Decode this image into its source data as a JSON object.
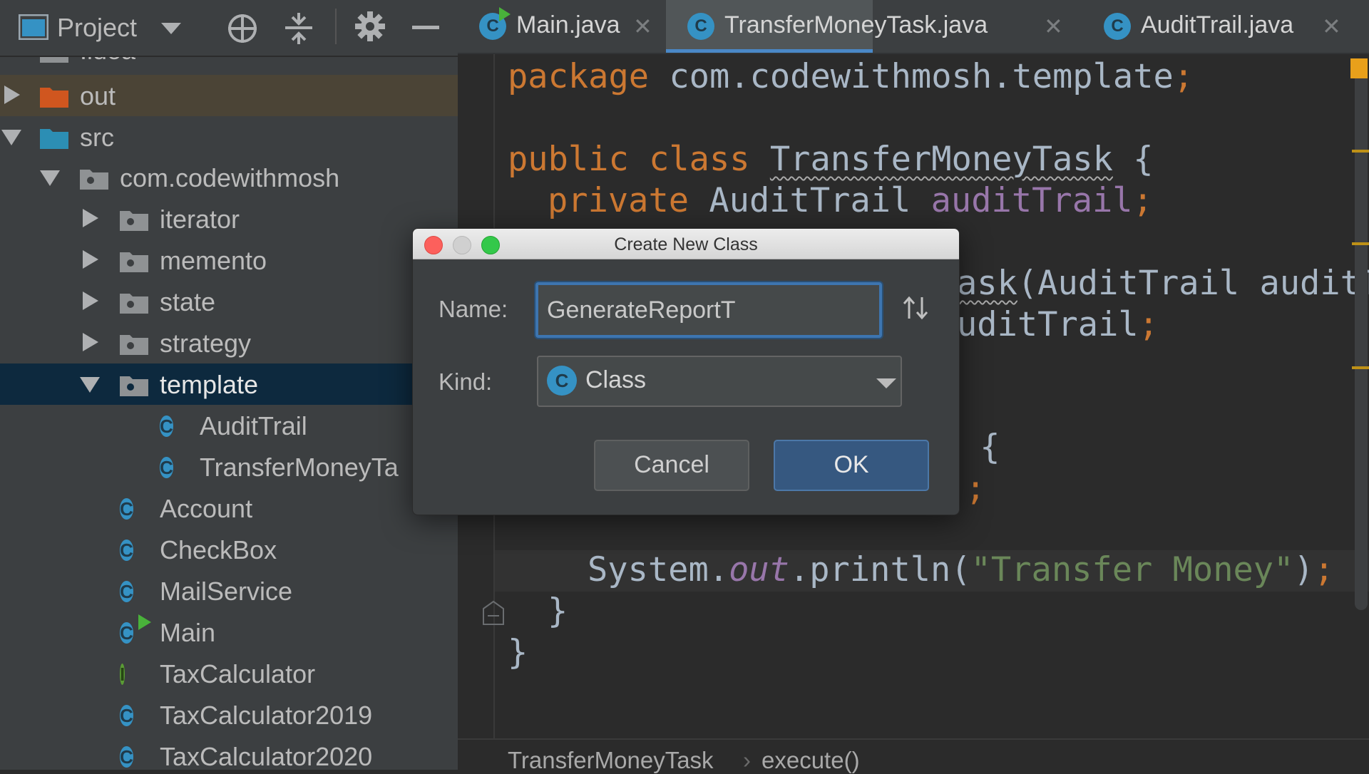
{
  "project_panel": {
    "title": "Project",
    "tree": [
      {
        "label": ".idea",
        "kind": "folder-gray"
      },
      {
        "label": "out",
        "kind": "folder-orange"
      },
      {
        "label": "src",
        "kind": "folder-blue"
      },
      {
        "label": "com.codewithmosh",
        "kind": "package"
      },
      {
        "label": "iterator",
        "kind": "package"
      },
      {
        "label": "memento",
        "kind": "package"
      },
      {
        "label": "state",
        "kind": "package"
      },
      {
        "label": "strategy",
        "kind": "package"
      },
      {
        "label": "template",
        "kind": "package"
      },
      {
        "label": "AuditTrail",
        "kind": "class"
      },
      {
        "label": "TransferMoneyTa",
        "kind": "class"
      },
      {
        "label": "Account",
        "kind": "class"
      },
      {
        "label": "CheckBox",
        "kind": "class"
      },
      {
        "label": "MailService",
        "kind": "class"
      },
      {
        "label": "Main",
        "kind": "class-main"
      },
      {
        "label": "TaxCalculator",
        "kind": "interface"
      },
      {
        "label": "TaxCalculator2019",
        "kind": "class"
      },
      {
        "label": "TaxCalculator2020",
        "kind": "class"
      }
    ]
  },
  "tabs": [
    {
      "label": "Main.java",
      "active": false
    },
    {
      "label": "TransferMoneyTask.java",
      "active": true
    },
    {
      "label": "AuditTrail.java",
      "active": false
    }
  ],
  "editor": {
    "l1_kw": "package ",
    "l1_pkg": "com.codewithmosh.template",
    "l1_semi": ";",
    "l2_kw": "public class ",
    "l2_cls": "TransferMoneyTask",
    "l2_brace": " {",
    "l3_kw": "private ",
    "l3_type": "AuditTrail ",
    "l3_fld": "auditTrail",
    "l3_semi": ";",
    "l4_frag": "ask",
    "l4_rest": "(AuditTrail auditT",
    "l5_frag": "uditTrail",
    "l5_semi": ";",
    "l6_frag": " {",
    "l7_frag": ";",
    "l8_a": "System.",
    "l8_out": "out",
    "l8_b": ".println(",
    "l8_str": "\"Transfer Money\"",
    "l8_c": ")",
    "l8_semi": ";",
    "l9": "}",
    "l10": "}"
  },
  "breadcrumb": {
    "class": "TransferMoneyTask",
    "sep": "›",
    "method": "execute()"
  },
  "dialog": {
    "title": "Create New Class",
    "name_label": "Name:",
    "name_value": "GenerateReportT",
    "kind_label": "Kind:",
    "kind_value": "Class",
    "cancel_label": "Cancel",
    "ok_label": "OK"
  },
  "icons": {
    "class_glyph": "C",
    "interface_glyph": "I"
  },
  "colors": {
    "accent": "#3d75b0",
    "keyword": "#cc7832",
    "field": "#9876aa",
    "string": "#6a8759",
    "selection": "#0d293e"
  }
}
